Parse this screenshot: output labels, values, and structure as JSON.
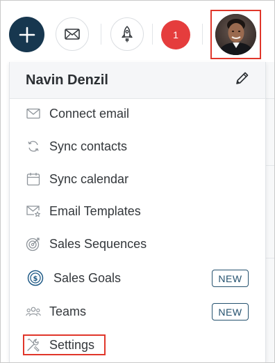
{
  "topbar": {
    "add_icon": "plus-icon",
    "mail_icon": "envelope-icon",
    "rocket_icon": "rocket-icon",
    "notifications_count": "1"
  },
  "user": {
    "name": "Navin Denzil",
    "edit_icon": "pencil-icon"
  },
  "menu": {
    "items": [
      {
        "label": "Connect email",
        "icon": "envelope-icon"
      },
      {
        "label": "Sync contacts",
        "icon": "sync-icon"
      },
      {
        "label": "Sync calendar",
        "icon": "calendar-icon"
      },
      {
        "label": "Email Templates",
        "icon": "template-icon"
      },
      {
        "label": "Sales Sequences",
        "icon": "target-icon"
      },
      {
        "label": "Sales Goals",
        "icon": "goal-icon",
        "tag": "NEW"
      },
      {
        "label": "Teams",
        "icon": "teams-icon",
        "tag": "NEW"
      },
      {
        "label": "Settings",
        "icon": "settings-icon"
      }
    ]
  },
  "colors": {
    "primary_dark": "#17374f",
    "badge_red": "#e53d3d",
    "highlight_red": "#e0362a",
    "tag_blue": "#24516e"
  }
}
